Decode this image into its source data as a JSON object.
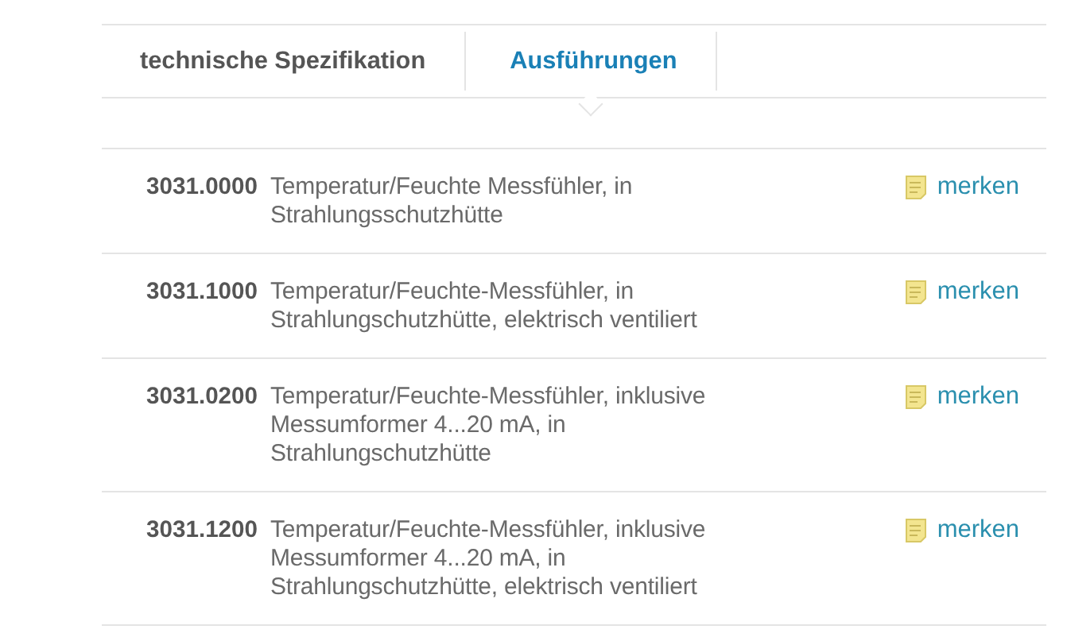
{
  "tabs": [
    {
      "label": "technische Spezifikation",
      "selected": false
    },
    {
      "label": "Ausführungen",
      "selected": true
    }
  ],
  "rows": [
    {
      "code": "3031.0000",
      "description": "Temperatur/Feuchte Messfühler, in Strahlungsschutzhütte",
      "action": "merken"
    },
    {
      "code": "3031.1000",
      "description": "Temperatur/Feuchte-Messfühler, in Strahlungschutzhütte, elektrisch ventiliert",
      "action": "merken"
    },
    {
      "code": "3031.0200",
      "description": "Temperatur/Feuchte-Messfühler, inklusive Messumformer 4...20 mA, in Strahlungschutzhütte",
      "action": "merken"
    },
    {
      "code": "3031.1200",
      "description": "Temperatur/Feuchte-Messfühler, inklusive Messumformer 4...20 mA, in Strahlungschutzhütte, elektrisch ventiliert",
      "action": "merken"
    }
  ]
}
